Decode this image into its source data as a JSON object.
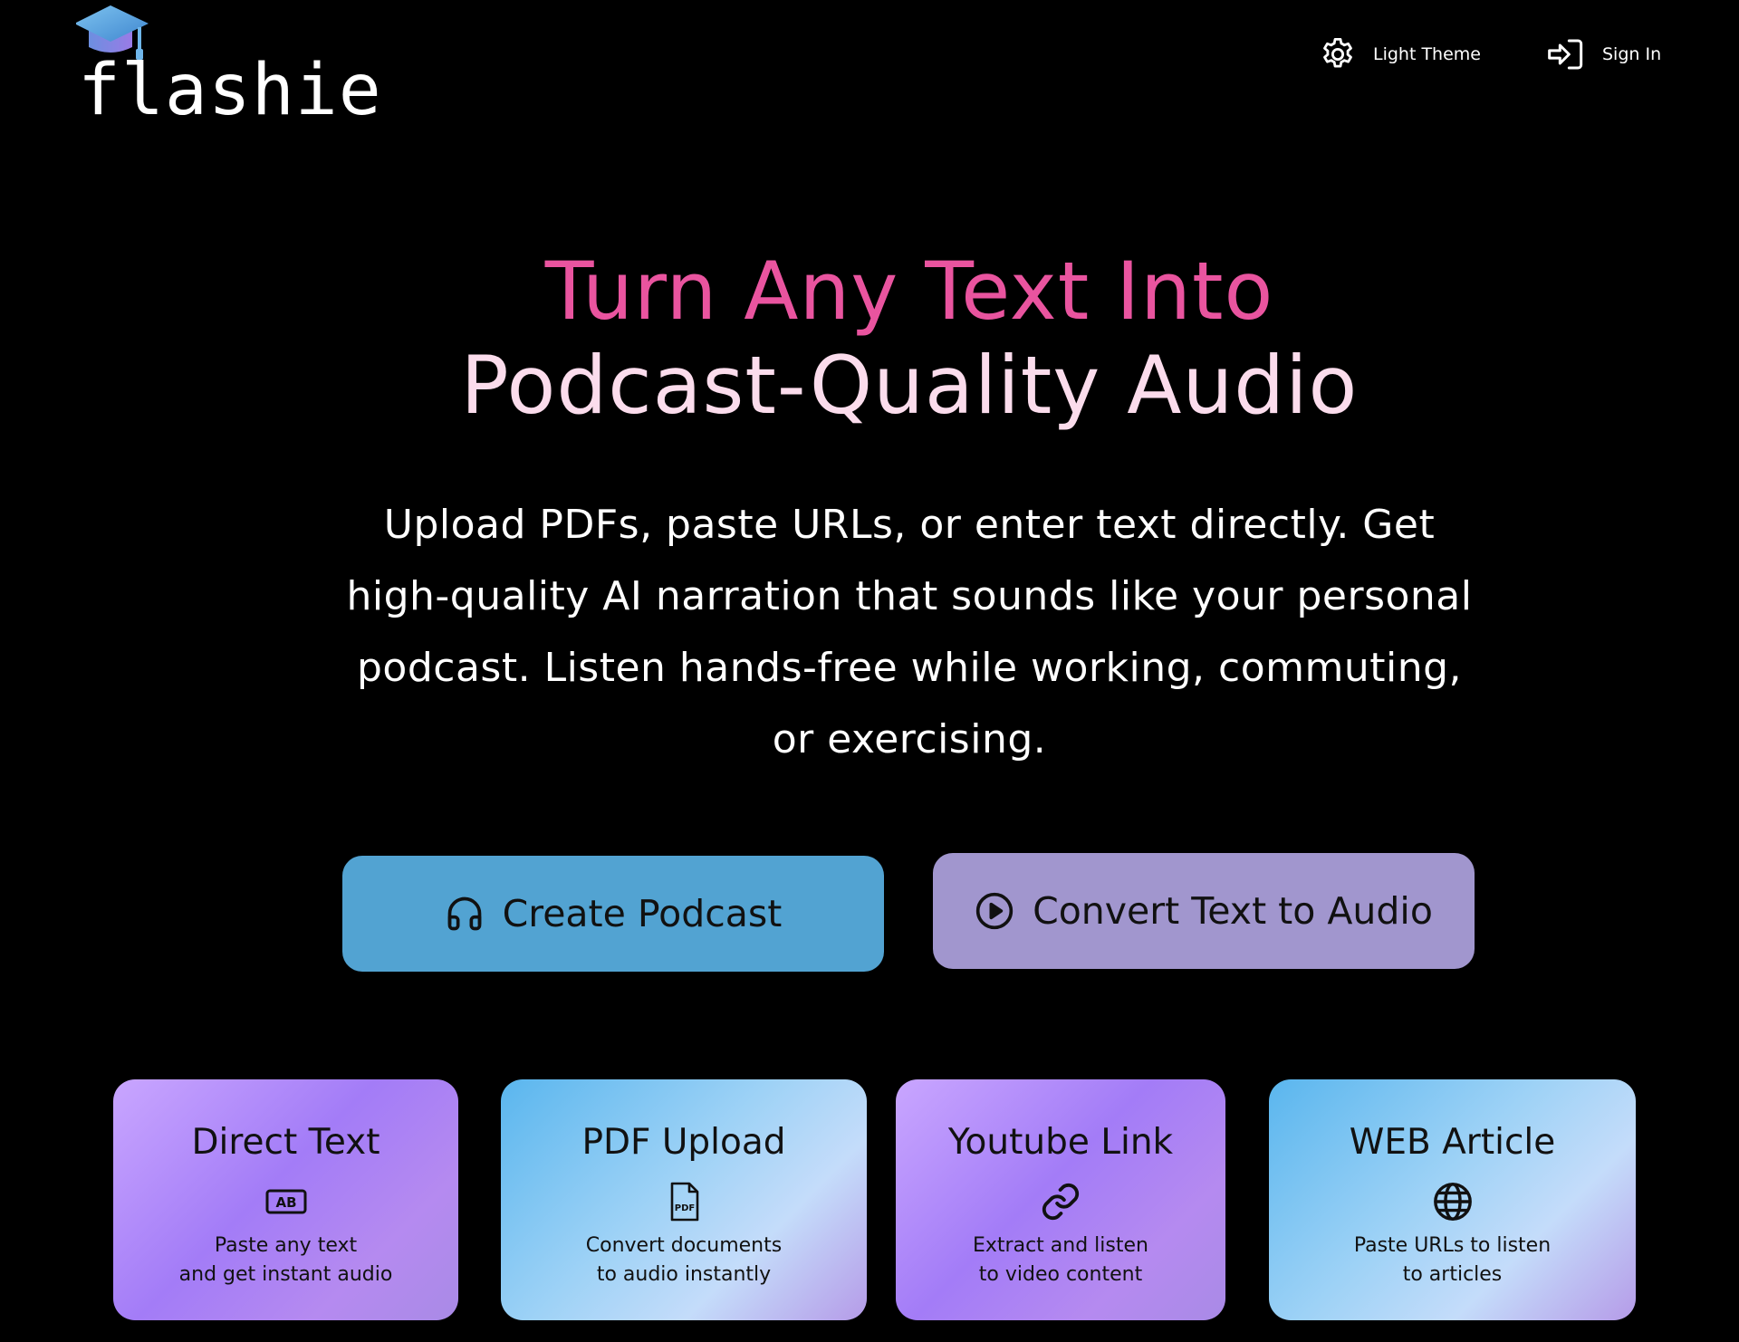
{
  "brand": {
    "name": "flashie",
    "logo_icon": "graduation-cap-icon"
  },
  "nav": {
    "theme_label": "Light Theme",
    "theme_icon": "gear-icon",
    "signin_label": "Sign In",
    "signin_icon": "sign-in-icon"
  },
  "hero": {
    "title_line1": "Turn Any Text Into",
    "title_line2": "Podcast-Quality Audio",
    "subtitle": "Upload PDFs, paste URLs, or enter text directly. Get high-quality AI narration that sounds like your personal podcast. Listen hands-free while working, commuting, or exercising."
  },
  "actions": {
    "create_label": "Create Podcast",
    "create_icon": "headphones-icon",
    "convert_label": "Convert Text to Audio",
    "convert_icon": "play-circle-icon"
  },
  "features": [
    {
      "title": "Direct Text",
      "icon": "text-ab-icon",
      "desc_line1": "Paste any text",
      "desc_line2": "and get instant audio"
    },
    {
      "title": "PDF Upload",
      "icon": "pdf-file-icon",
      "desc_line1": "Convert documents",
      "desc_line2": "to audio instantly"
    },
    {
      "title": "Youtube Link",
      "icon": "link-icon",
      "desc_line1": "Extract and listen",
      "desc_line2": "to video content"
    },
    {
      "title": "WEB Article",
      "icon": "globe-icon",
      "desc_line1": "Paste URLs to listen",
      "desc_line2": "to articles"
    }
  ],
  "colors": {
    "background": "#000000",
    "title_accent": "#e9549f",
    "title_secondary": "#fbdcec",
    "create_button": "#52a3d2",
    "convert_button": "#a196ce"
  }
}
